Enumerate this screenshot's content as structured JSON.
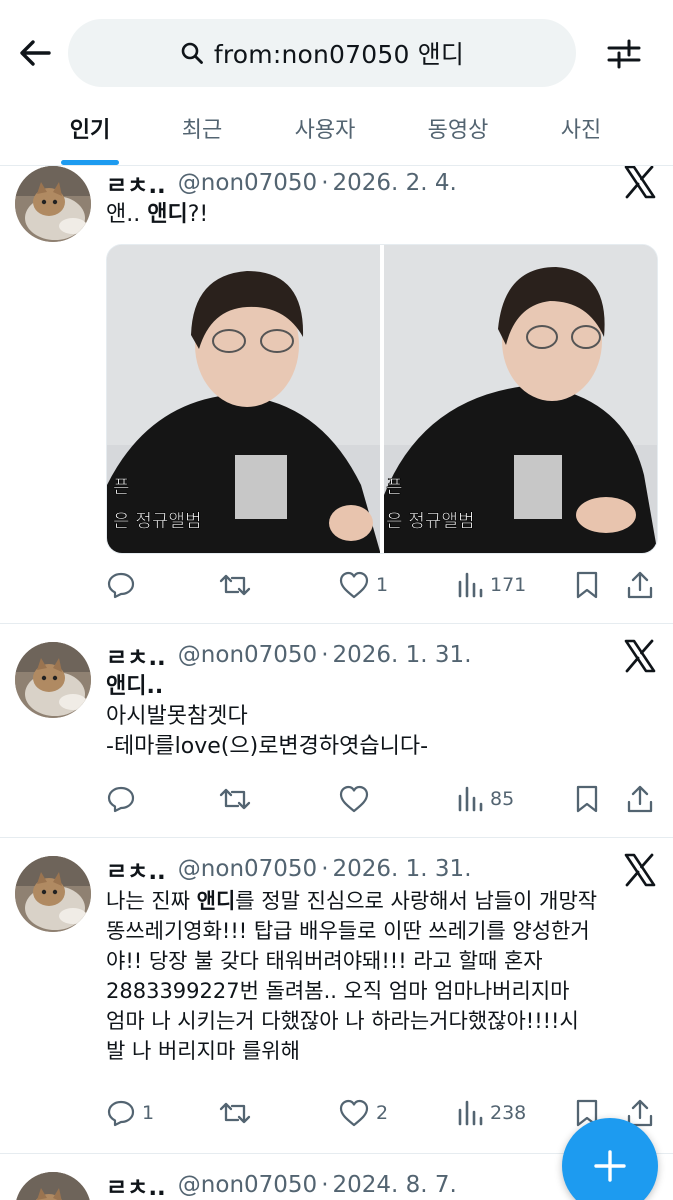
{
  "header": {
    "search_query": "from:non07050 앤디",
    "tabs": [
      {
        "label": "인기",
        "active": true
      },
      {
        "label": "최근",
        "active": false
      },
      {
        "label": "사용자",
        "active": false
      },
      {
        "label": "동영상",
        "active": false
      },
      {
        "label": "사진",
        "active": false
      }
    ]
  },
  "tweets": [
    {
      "name": "ㄹㅊ..",
      "handle": "@non07050",
      "date": "2026. 2. 4.",
      "text": {
        "prefix": "앤..  ",
        "bold": "앤디",
        "suffix": "?!"
      },
      "subtitle_left": "은 정규앨범",
      "subtitle_right": "은 정규앨범",
      "actions": {
        "reply": "",
        "retweet": "",
        "like": "1",
        "views": "171"
      }
    },
    {
      "name": "ㄹㅊ..",
      "handle": "@non07050",
      "date": "2026. 1. 31.",
      "lines": [
        "앤디..",
        "아시발못참겟다",
        "-테마를love(으)로변경하엿습니다-"
      ],
      "actions": {
        "reply": "",
        "retweet": "",
        "like": "",
        "views": "85"
      }
    },
    {
      "name": "ㄹㅊ..",
      "handle": "@non07050",
      "date": "2026. 1. 31.",
      "line1": {
        "prefix": "나는 진짜 ",
        "bold": "앤디",
        "suffix": "를 정말 진심으로 사랑해서 남들이 개망작"
      },
      "lines": [
        "똥쓰레기영화!!! 탑급 배우들로 이딴 쓰레기를 양성한거",
        "야!! 당장 불 갖다 태워버려야돼!!!   라고 할때 혼자",
        "2883399227번 돌려봄..   오직 엄마   엄마나버리지마",
        "엄마 나 시키는거 다했잖아    나 하라는거다했잖아!!!!시",
        "발 나 버리지마 를위해"
      ],
      "actions": {
        "reply": "1",
        "retweet": "",
        "like": "2",
        "views": "238"
      }
    },
    {
      "name": "ㄹㅊ..",
      "handle": "@non07050",
      "date": "2024. 8. 7."
    }
  ]
}
